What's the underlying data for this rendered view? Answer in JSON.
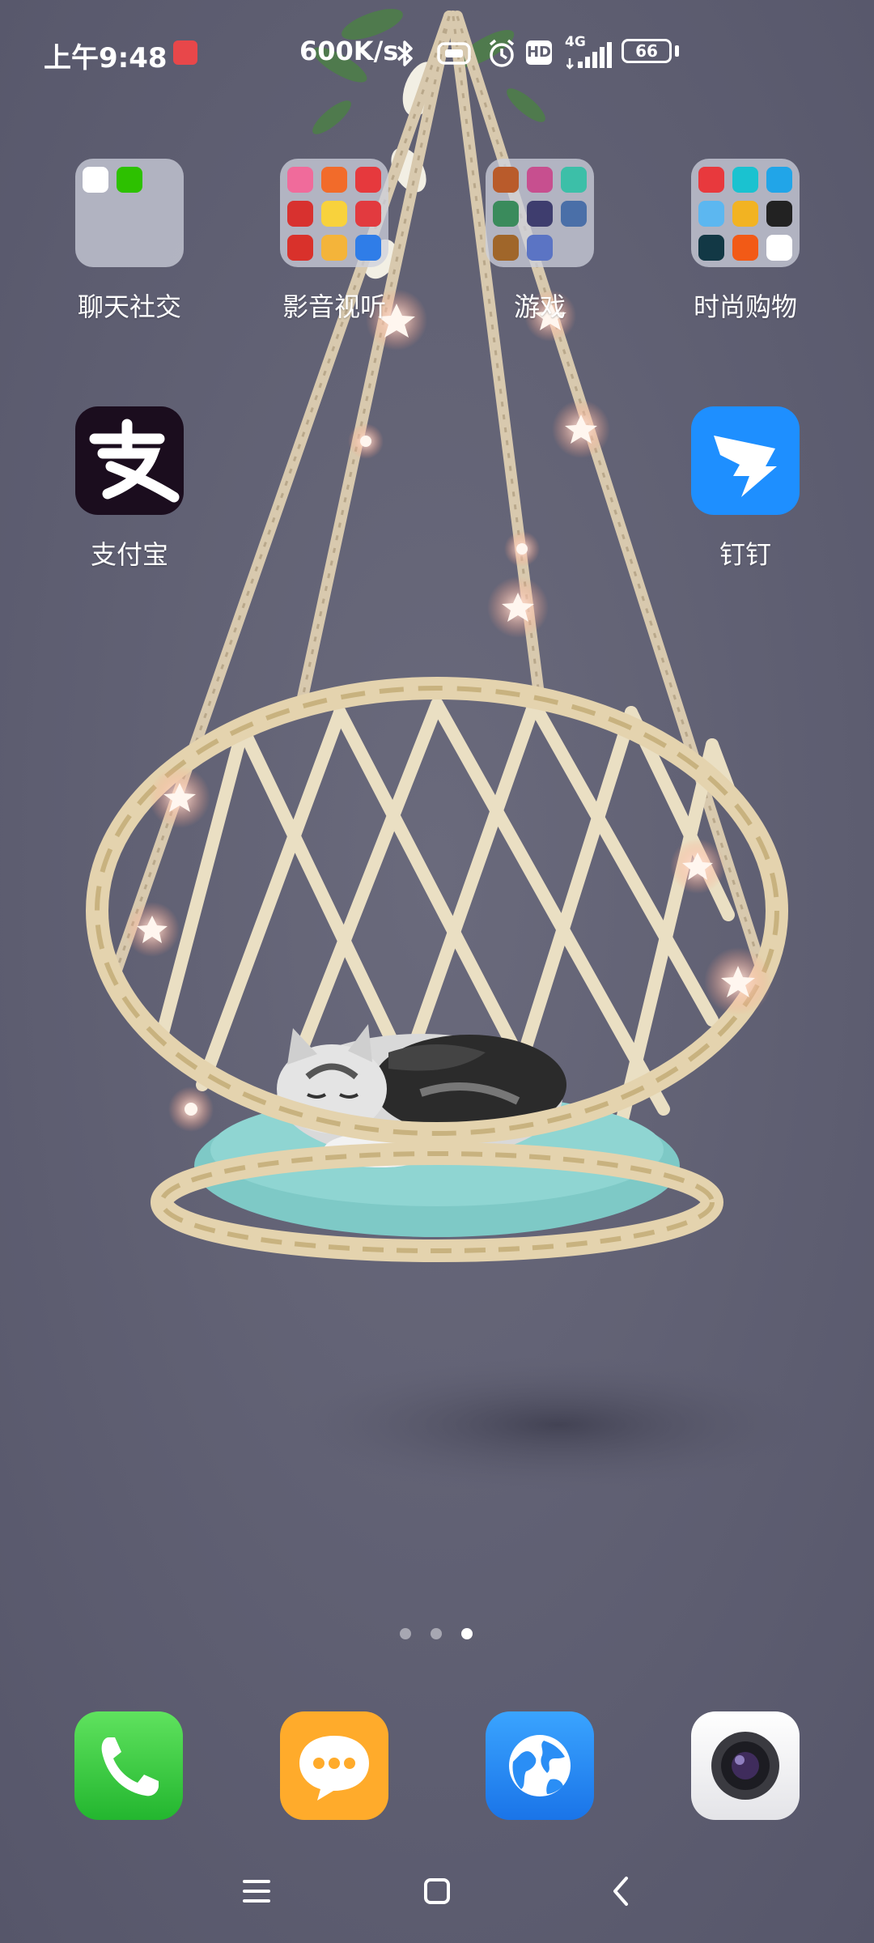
{
  "status_bar": {
    "time": "上午9:48",
    "network_speed": "600K/s",
    "network_type": "4G",
    "hd_badge": "HD",
    "battery": "66",
    "icons": [
      "notification-app-icon",
      "bluetooth-icon",
      "vibrate-icon",
      "alarm-icon",
      "hd-icon",
      "signal-icon",
      "battery-icon"
    ]
  },
  "folders": [
    {
      "label": "聊天社交"
    },
    {
      "label": "影音视听"
    },
    {
      "label": "游戏"
    },
    {
      "label": "时尚购物"
    }
  ],
  "apps": [
    {
      "label": "支付宝"
    },
    {
      "label": "钉钉"
    }
  ],
  "page_indicator": {
    "total": 3,
    "current": 3
  },
  "dock": [
    "phone-icon",
    "messages-icon",
    "browser-icon",
    "camera-icon"
  ],
  "nav_bar": [
    "menu-icon",
    "home-icon",
    "back-icon"
  ],
  "colors": {
    "background": "#5e5e70",
    "alipay": "#1b0d1e",
    "dingtalk": "#1e8fff",
    "phone": "#3fcf45",
    "messages": "#ffab2b",
    "browser": "#2a8ef5",
    "camera": "#f2f2f4"
  }
}
